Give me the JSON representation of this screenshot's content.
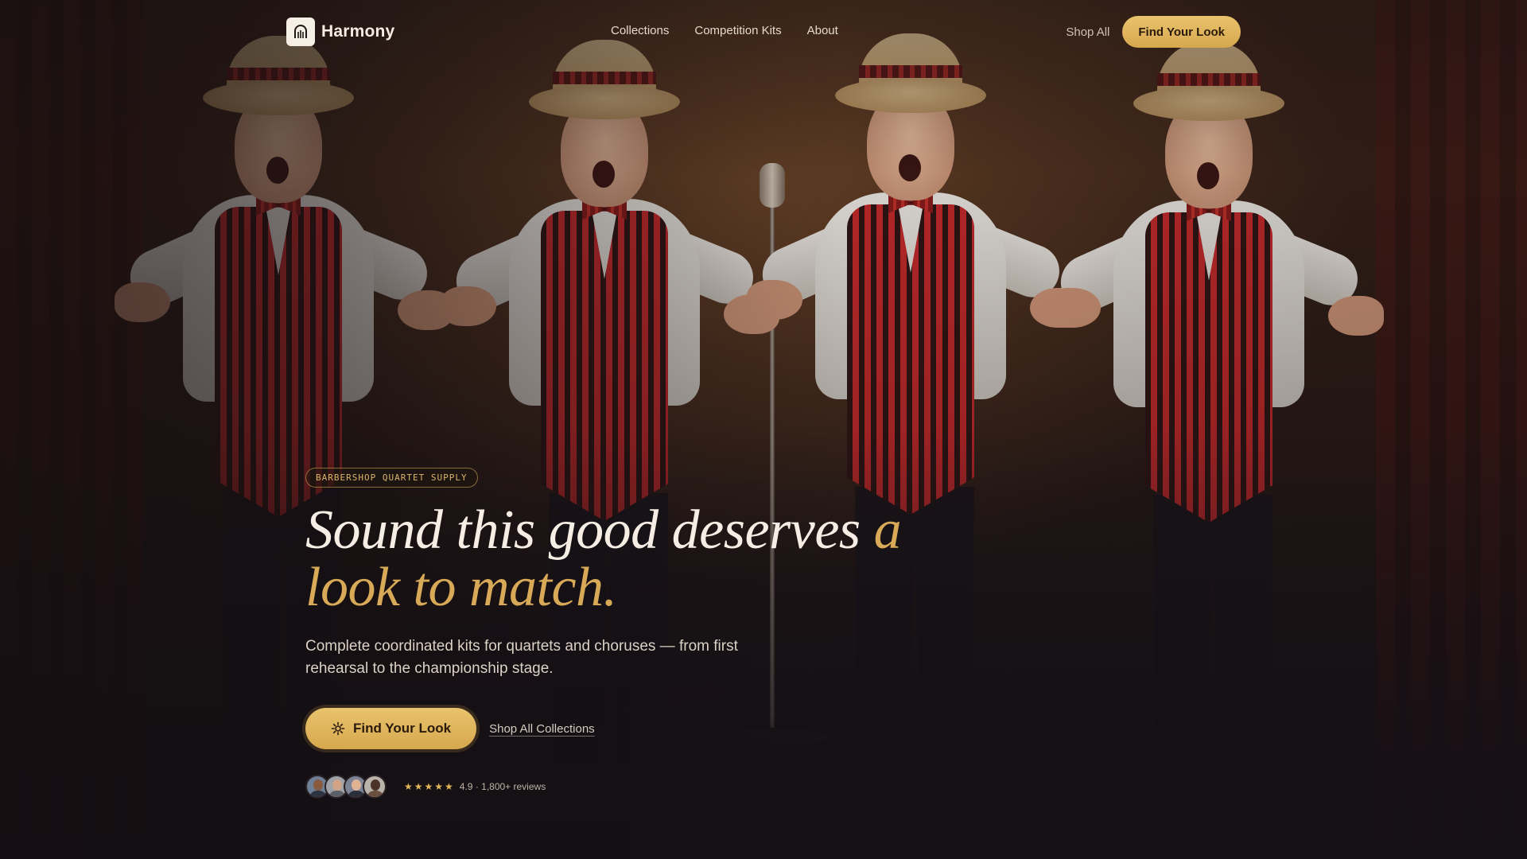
{
  "brand": {
    "name": "Harmony",
    "logo_icon": "arch-icon"
  },
  "nav": {
    "links": [
      "Collections",
      "Competition Kits",
      "About"
    ],
    "shop_all": "Shop All",
    "cta": "Find Your Look"
  },
  "hero": {
    "eyebrow": "BARBERSHOP QUARTET SUPPLY",
    "headline_main": "Sound this good deserves ",
    "headline_accent": "a look to match.",
    "subcopy": "Complete coordinated kits for quartets and choruses — from first rehearsal to the championship stage.",
    "cta_icon": "sparkle-icon",
    "cta": "Find Your Look",
    "secondary_link": "Shop All Collections"
  },
  "social_proof": {
    "avatar_count": 4,
    "stars": "★★★★★",
    "rating": "4.9",
    "reviews": "1,800+ reviews",
    "rating_text": "4.9 · 1,800+ reviews"
  },
  "colors": {
    "accent": "#d8a957",
    "button": "#e2b862",
    "background": "#1a1418",
    "vest_red": "#c8292a"
  }
}
